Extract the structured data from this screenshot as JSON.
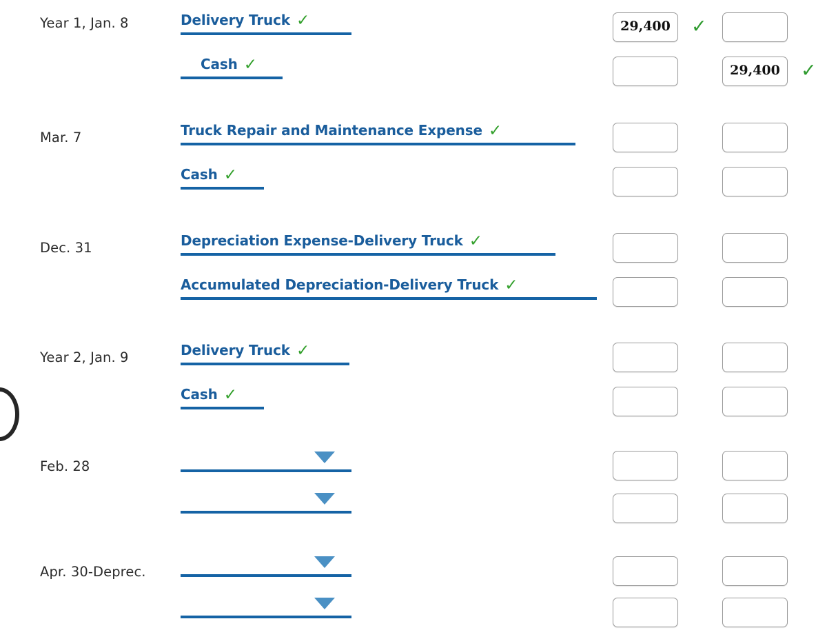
{
  "colors": {
    "account_blue": "#1a5d9c",
    "underline_blue": "#1563a5",
    "caret_blue": "#4a90c4",
    "check_green": "#33a02c",
    "date_text": "#2b2b2b",
    "box_border": "#9a9a9a"
  },
  "icons": {
    "check": "check-icon",
    "caret": "chevron-down-icon",
    "cursor": "cursor-ring-icon"
  },
  "symbols": {
    "check_glyph": "✓"
  },
  "entries": [
    {
      "date": "Year 1, Jan. 8",
      "lines": [
        {
          "account": "Delivery Truck",
          "account_verified": true,
          "indent": false,
          "line_width": 248,
          "type": "text",
          "debit": "29,400",
          "credit": "",
          "debit_verified": true,
          "credit_verified": false
        },
        {
          "account": "Cash",
          "account_verified": true,
          "indent": true,
          "line_width": 148,
          "type": "text",
          "debit": "",
          "credit": "29,400",
          "debit_verified": false,
          "credit_verified": true
        }
      ]
    },
    {
      "date": "Mar. 7",
      "lines": [
        {
          "account": "Truck Repair and Maintenance Expense",
          "account_verified": true,
          "indent": false,
          "line_width": 573,
          "type": "text",
          "debit": "",
          "credit": "",
          "debit_verified": false,
          "credit_verified": false
        },
        {
          "account": "Cash",
          "account_verified": true,
          "indent": false,
          "line_width": 121,
          "type": "text",
          "debit": "",
          "credit": "",
          "debit_verified": false,
          "credit_verified": false
        }
      ]
    },
    {
      "date": "Dec. 31",
      "lines": [
        {
          "account": "Depreciation Expense-Delivery Truck",
          "account_verified": true,
          "indent": false,
          "line_width": 544,
          "type": "text",
          "debit": "",
          "credit": "",
          "debit_verified": false,
          "credit_verified": false
        },
        {
          "account": "Accumulated Depreciation-Delivery Truck",
          "account_verified": true,
          "indent": false,
          "line_width": 604,
          "type": "text",
          "debit": "",
          "credit": "",
          "debit_verified": false,
          "credit_verified": false
        }
      ]
    },
    {
      "date": "Year 2, Jan. 9",
      "lines": [
        {
          "account": "Delivery Truck",
          "account_verified": true,
          "indent": false,
          "line_width": 245,
          "type": "text",
          "debit": "",
          "credit": "",
          "debit_verified": false,
          "credit_verified": false
        },
        {
          "account": "Cash",
          "account_verified": true,
          "indent": false,
          "line_width": 121,
          "type": "text",
          "debit": "",
          "credit": "",
          "debit_verified": false,
          "credit_verified": false
        }
      ]
    },
    {
      "date": "Feb. 28",
      "lines": [
        {
          "account": "",
          "account_verified": false,
          "indent": false,
          "line_width": 248,
          "type": "select",
          "debit": "",
          "credit": "",
          "debit_verified": false,
          "credit_verified": false
        },
        {
          "account": "",
          "account_verified": false,
          "indent": false,
          "line_width": 248,
          "type": "select",
          "debit": "",
          "credit": "",
          "debit_verified": false,
          "credit_verified": false
        }
      ]
    },
    {
      "date": "Apr. 30-Deprec.",
      "lines": [
        {
          "account": "",
          "account_verified": false,
          "indent": false,
          "line_width": 248,
          "type": "select",
          "debit": "",
          "credit": "",
          "debit_verified": false,
          "credit_verified": false
        },
        {
          "account": "",
          "account_verified": false,
          "indent": false,
          "line_width": 248,
          "type": "select",
          "debit": "",
          "credit": "",
          "debit_verified": false,
          "credit_verified": false
        }
      ]
    }
  ]
}
